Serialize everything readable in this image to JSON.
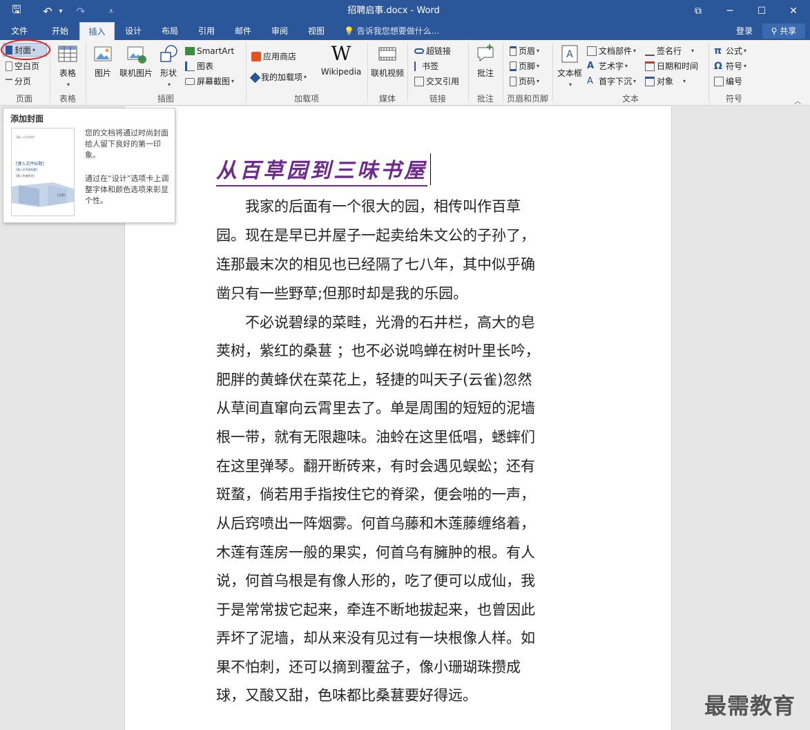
{
  "titlebar": {
    "title": "招聘启事.docx - Word",
    "quick_access": {
      "save": "🖫",
      "undo": "↶",
      "undo_caret": "▾",
      "redo": "↷",
      "customize": "⩡"
    },
    "window_buttons": {
      "ribbon_display": "⧉",
      "minimize": "─",
      "maximize": "☐",
      "close": "✕"
    }
  },
  "tabs": [
    {
      "label": "文件",
      "active": false
    },
    {
      "label": "开始",
      "active": false
    },
    {
      "label": "插入",
      "active": true
    },
    {
      "label": "设计",
      "active": false
    },
    {
      "label": "布局",
      "active": false
    },
    {
      "label": "引用",
      "active": false
    },
    {
      "label": "邮件",
      "active": false
    },
    {
      "label": "审阅",
      "active": false
    },
    {
      "label": "视图",
      "active": false
    }
  ],
  "tellme": "告诉我您想要做什么...",
  "login": "登录",
  "share": "共享",
  "ribbon": {
    "pages": {
      "cover": "封面",
      "blank": "空白页",
      "break": "分页",
      "group": "页面"
    },
    "table": {
      "table": "表格",
      "group": "表格"
    },
    "illustrations": {
      "picture": "图片",
      "online_picture": "联机图片",
      "shapes": "形状",
      "smartart": "SmartArt",
      "chart": "图表",
      "screenshot": "屏幕截图",
      "group": "插图"
    },
    "addins": {
      "store": "应用商店",
      "my_addins": "我的加载项",
      "wikipedia": "Wikipedia",
      "wiki_logo": "W",
      "group": "加载项"
    },
    "media": {
      "online_video": "联机视频",
      "group": "媒体"
    },
    "links": {
      "hyperlink": "超链接",
      "bookmark": "书签",
      "crossref": "交叉引用",
      "group": "链接"
    },
    "comments": {
      "comment": "批注",
      "group": "批注"
    },
    "header_footer": {
      "header": "页眉",
      "footer": "页脚",
      "page_number": "页码",
      "group": "页眉和页脚"
    },
    "text": {
      "textbox": "文本框",
      "quick_parts": "文档部件",
      "wordart": "艺术字",
      "dropcap": "首字下沉",
      "signature": "签名行",
      "datetime": "日期和时间",
      "object": "对象",
      "group": "文本"
    },
    "symbols": {
      "equation": "公式",
      "symbol": "符号",
      "numbering": "编号",
      "group": "符号"
    }
  },
  "popup": {
    "title": "添加封面",
    "desc1": "您的文档将通过时尚封面给人留下良好的第一印象。",
    "desc2": "通过在“设计”选项卡上调整字体和颜色选项来彰显个性。",
    "thumb_heading": "[键入文件标题]",
    "thumb_sub": "[键入文件副标题]",
    "thumb_top": "[键入公司名称]",
    "thumb_author": "[键入作者姓名]",
    "thumb_date": "[日期]"
  },
  "document": {
    "title": "从百草园到三味书屋",
    "lines": [
      "　　我家的后面有一个很大的园，相传叫作百草",
      "园。现在是早已并屋子一起卖给朱文公的子孙了，",
      "连那最末次的相见也已经隔了七八年，其中似乎确",
      "凿只有一些野草;但那时却是我的乐园。",
      "　　不必说碧绿的菜畦，光滑的石井栏，高大的皂",
      "荚树，紫红的桑葚 ；也不必说鸣蝉在树叶里长吟，",
      "肥胖的黄蜂伏在菜花上，轻捷的叫天子(云雀)忽然",
      "从草间直窜向云霄里去了。单是周围的短短的泥墙",
      "根一带，就有无限趣味。油蛉在这里低唱，蟋蟀们",
      "在这里弹琴。翻开断砖来，有时会遇见蜈蚣；还有",
      "斑蝥，倘若用手指按住它的脊梁，便会啪的一声，",
      "从后窍喷出一阵烟雾。何首乌藤和木莲藤缠络着，",
      "木莲有莲房一般的果实，何首乌有臃肿的根。有人",
      "说，何首乌根是有像人形的，吃了便可以成仙，我",
      "于是常常拔它起来，牵连不断地拔起来，也曾因此",
      "弄坏了泥墙，却从来没有见过有一块根像人样。如",
      "果不怕刺，还可以摘到覆盆子，像小珊瑚珠攒成",
      "球，又酸又甜，色味都比桑葚要好得远。"
    ]
  },
  "watermark": "最需教育",
  "colors": {
    "brand": "#2b579a",
    "title_purple": "#6c2a8c",
    "highlight_ring": "#e02020"
  }
}
